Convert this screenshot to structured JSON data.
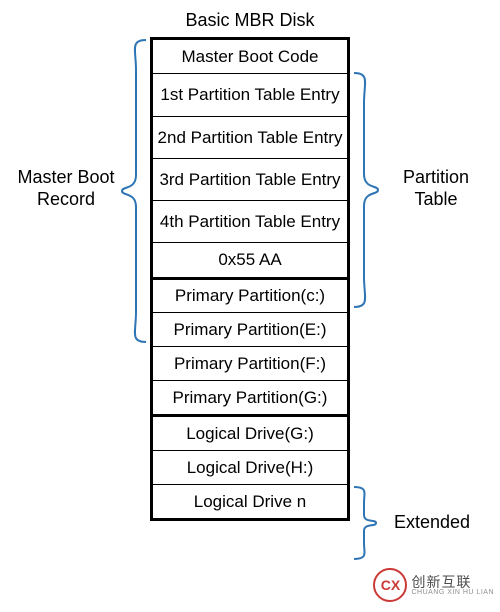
{
  "title": "Basic MBR Disk",
  "mbr_section": {
    "boot_code": "Master Boot Code",
    "entry1": "1st Partition Table Entry",
    "entry2": "2nd Partition Table Entry",
    "entry3": "3rd Partition Table Entry",
    "entry4": "4th Partition Table Entry",
    "signature": "0x55 AA"
  },
  "primary": {
    "p1": "Primary Partition(c:)",
    "p2": "Primary Partition(E:)",
    "p3": "Primary Partition(F:)",
    "p4": "Primary Partition(G:)"
  },
  "extended": {
    "l1": "Logical Drive(G:)",
    "l2": "Logical Drive(H:)",
    "l3": "Logical Drive n"
  },
  "labels": {
    "mbr": "Master Boot Record",
    "ptable": "Partition Table",
    "ext": "Extended"
  },
  "watermark": {
    "logo": "CX",
    "cn": "创新互联",
    "en": "CHUANG XIN HU LIAN"
  }
}
